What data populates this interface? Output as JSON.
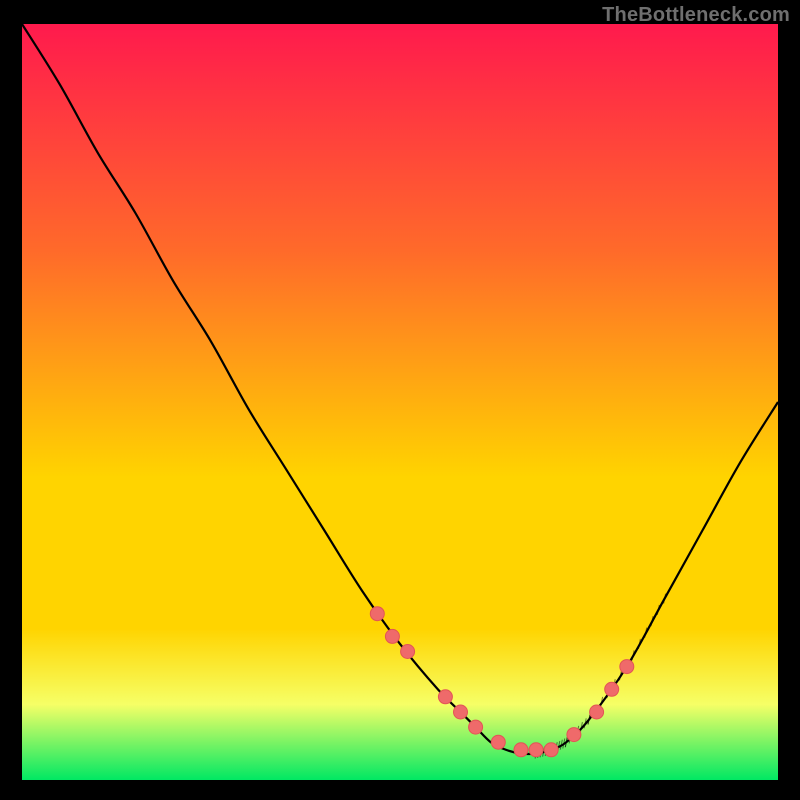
{
  "watermark": "TheBottleneck.com",
  "colors": {
    "background": "#000000",
    "watermark_text": "#6f6f6f",
    "gradient": {
      "top": "#ff1a4d",
      "upper": "#ff6a2a",
      "mid": "#ffd400",
      "lower": "#f6ff66",
      "bottom": "#00e863"
    },
    "curve": "#000000",
    "marker_fill": "#ef6a6a",
    "marker_stroke": "#e25555"
  },
  "chart_data": {
    "type": "line",
    "title": "",
    "xlabel": "",
    "ylabel": "",
    "xlim": [
      0,
      100
    ],
    "ylim": [
      0,
      100
    ],
    "series": [
      {
        "name": "bottleneck-curve",
        "x": [
          0,
          5,
          10,
          15,
          20,
          25,
          30,
          35,
          40,
          45,
          50,
          55,
          58,
          60,
          62,
          64,
          66,
          68,
          70,
          72,
          75,
          80,
          85,
          90,
          95,
          100
        ],
        "y": [
          100,
          92,
          83,
          75,
          66,
          58,
          49,
          41,
          33,
          25,
          18,
          12,
          9,
          7,
          5,
          4,
          3.5,
          3.5,
          4,
          5,
          8,
          15,
          24,
          33,
          42,
          50
        ]
      }
    ],
    "markers": {
      "name": "highlighted-points",
      "x": [
        47,
        49,
        51,
        56,
        58,
        60,
        63,
        66,
        68,
        70,
        73,
        76,
        78,
        80
      ],
      "y": [
        22,
        19,
        17,
        11,
        9,
        7,
        5,
        4,
        4,
        4,
        6,
        9,
        12,
        15
      ]
    }
  }
}
